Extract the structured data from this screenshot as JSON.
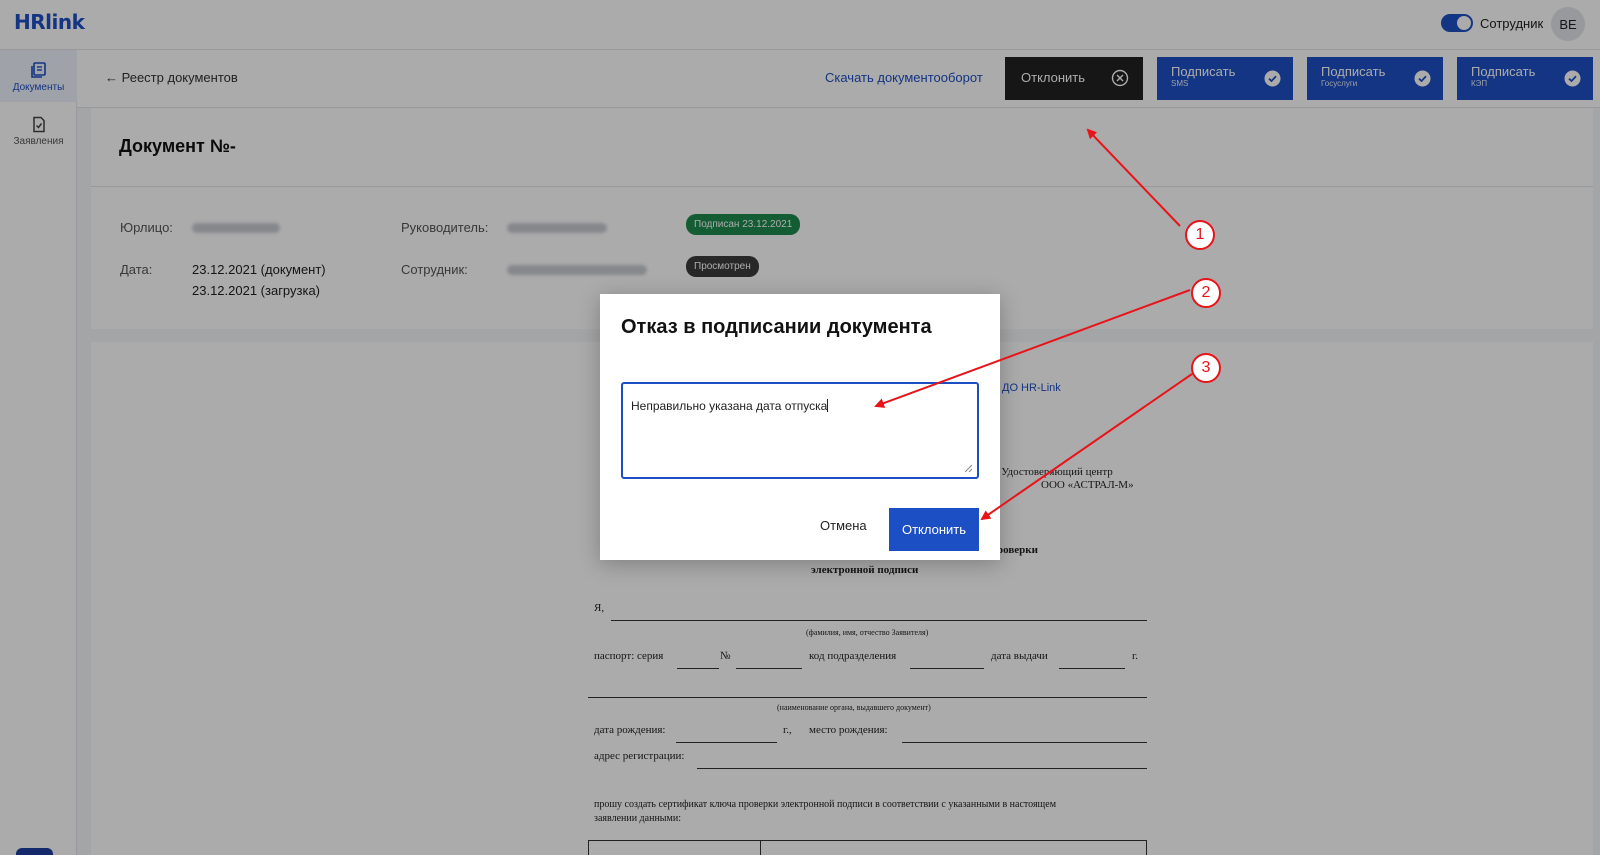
{
  "header": {
    "logo": "HRlink",
    "role_label": "Сотрудник",
    "avatar_initials": "BE"
  },
  "sidebar": {
    "items": [
      {
        "label": "Документы",
        "active": true
      },
      {
        "label": "Заявления",
        "active": false
      }
    ],
    "help_label": "?"
  },
  "actions": {
    "back_label": "Реестр документов",
    "download_label": "Скачать документооборот",
    "reject_label": "Отклонить",
    "sign_buttons": [
      {
        "label": "Подписать",
        "sub": "SMS"
      },
      {
        "label": "Подписать",
        "sub": "Госуслуги"
      },
      {
        "label": "Подписать",
        "sub": "КЭП"
      }
    ]
  },
  "document": {
    "title": "Документ №-",
    "entity_label": "Юрлицо:",
    "manager_label": "Руководитель:",
    "date_label": "Дата:",
    "date_doc": "23.12.2021 (документ)",
    "date_upload": "23.12.2021 (загрузка)",
    "employee_label": "Сотрудник:",
    "status_signed": "Подписан 23.12.2021",
    "status_viewed": "Просмотрен"
  },
  "paper": {
    "edo_fragment": "ДО HR-Link",
    "uc_line1": "вый Удостоверяющий центр",
    "uc_line2": "ООО «АСТРАЛ-М»",
    "heading_frag": "роверки",
    "heading_line2": "электронной подписи",
    "ya": "Я,",
    "fio_hint": "(фамилия, имя, отчество Заявителя)",
    "passport_series": "паспорт: серия",
    "num_sign": "№",
    "dept_code": "код подразделения",
    "issue_date": "дата выдачи",
    "year_abbr": "г.",
    "issuer_hint": "(наименование органа, выдавшего документ)",
    "birth_date": "дата рождения:",
    "year_abbr2": "г.,",
    "birth_place": "место рождения:",
    "reg_address": "адрес регистрации:",
    "request_line1": "прошу создать сертификат ключа проверки электронной подписи в соответствии с указанными в настоящем",
    "request_line2": "заявлении данными:"
  },
  "modal": {
    "title": "Отказ в подписании документа",
    "textarea_value": "Неправильно указана дата отпуска",
    "cancel_label": "Отмена",
    "confirm_label": "Отклонить"
  },
  "annotations": {
    "marker1": "1",
    "marker2": "2",
    "marker3": "3",
    "color": "#e8141a"
  },
  "colors": {
    "brand": "#1d4fc4",
    "reject_bg": "#222222",
    "badge_signed": "#1f8a4c",
    "badge_viewed": "#3d3d3d"
  }
}
